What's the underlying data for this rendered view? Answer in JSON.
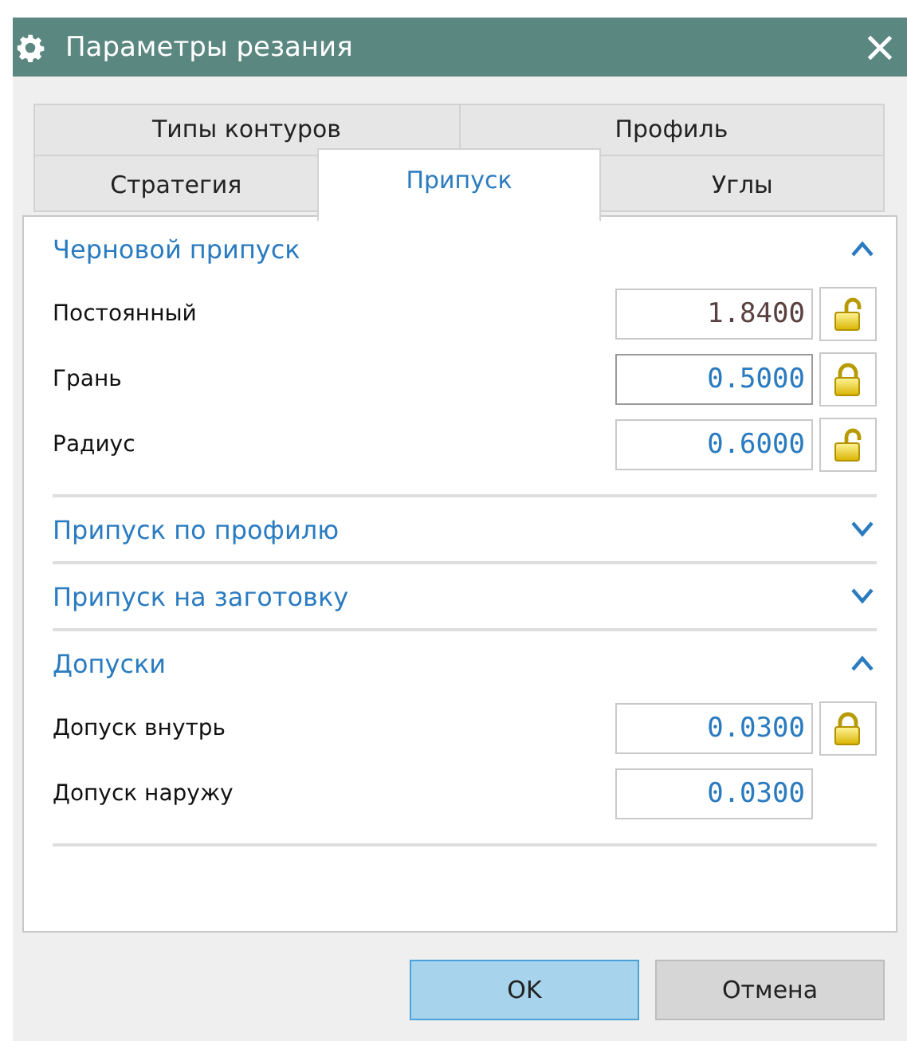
{
  "window": {
    "title": "Параметры резания"
  },
  "tab_rows": [
    [
      {
        "label": "Типы контуров",
        "selected": false
      },
      {
        "label": "Профиль",
        "selected": false
      }
    ],
    [
      {
        "label": "Стратегия",
        "selected": false
      },
      {
        "label": "Припуск",
        "selected": true
      },
      {
        "label": "Углы",
        "selected": false
      }
    ]
  ],
  "sections": [
    {
      "title": "Черновой припуск",
      "expanded": true,
      "fields": [
        {
          "label": "Постоянный",
          "value": "1.8400",
          "edited": true,
          "focused": false,
          "locked": false
        },
        {
          "label": "Грань",
          "value": "0.5000",
          "edited": false,
          "focused": true,
          "locked": true
        },
        {
          "label": "Радиус",
          "value": "0.6000",
          "edited": false,
          "focused": false,
          "locked": false
        }
      ]
    },
    {
      "title": "Припуск по профилю",
      "expanded": false
    },
    {
      "title": "Припуск на заготовку",
      "expanded": false
    },
    {
      "title": "Допуски",
      "expanded": true,
      "fields": [
        {
          "label": "Допуск внутрь",
          "value": "0.0300",
          "edited": false,
          "focused": false,
          "locked": true
        },
        {
          "label": "Допуск наружу",
          "value": "0.0300",
          "edited": false,
          "focused": false
        }
      ]
    }
  ],
  "buttons": [
    {
      "label": "OK",
      "kind": "default"
    },
    {
      "label": "Отмена",
      "kind": "normal"
    }
  ]
}
